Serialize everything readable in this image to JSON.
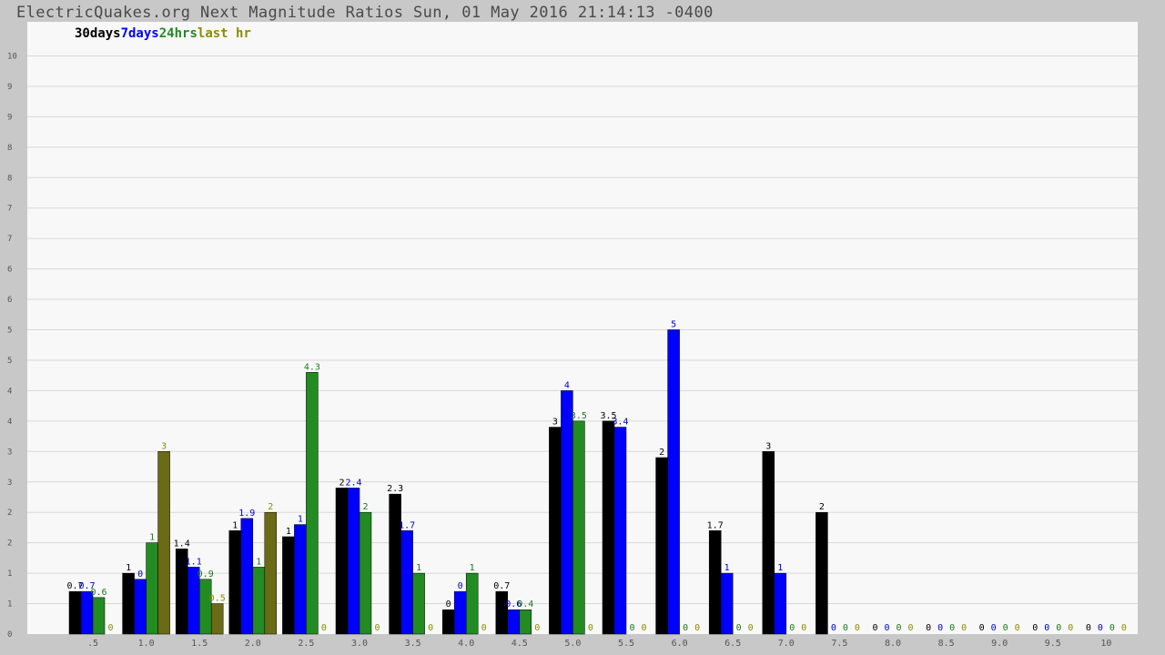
{
  "title": "ElectricQuakes.org Next Magnitude Ratios Sun, 01 May 2016 21:14:13 -0400",
  "colors": {
    "background": "#c8c8c8",
    "plot_bg": "#f8f8f8",
    "grid": "#d8d8d8",
    "series": [
      "#000000",
      "#0000ff",
      "#228b22",
      "#6b6b16"
    ]
  },
  "chart_data": {
    "type": "bar",
    "title": "ElectricQuakes.org Next Magnitude Ratios Sun, 01 May 2016 21:14:13 -0400",
    "xlabel": "",
    "ylabel": "",
    "ylim": [
      0,
      10
    ],
    "grid": true,
    "legend_position": "top-left",
    "categories": [
      ".5",
      "1.0",
      "1.5",
      "2.0",
      "2.5",
      "3.0",
      "3.5",
      "4.0",
      "4.5",
      "5.0",
      "5.5",
      "6.0",
      "6.5",
      "7.0",
      "7.5",
      "8.0",
      "8.5",
      "9.0",
      "9.5",
      "10"
    ],
    "y_tick_labels": [
      "0",
      "1",
      "1",
      "2",
      "2",
      "3",
      "3",
      "4",
      "4",
      "5",
      "5",
      "6",
      "6",
      "7",
      "7",
      "8",
      "8",
      "9",
      "9",
      "10"
    ],
    "series": [
      {
        "name": "30days",
        "values": [
          0.7,
          1.0,
          1.4,
          1.7,
          1.6,
          2.4,
          2.3,
          0.4,
          0.7,
          3.4,
          3.5,
          2.9,
          1.7,
          3.0,
          2.0,
          0,
          0,
          0,
          0,
          0
        ],
        "labels": [
          "0.7",
          "1",
          "1.4",
          "1",
          "1",
          "2",
          "2.3",
          "0",
          "0.7",
          "3",
          "3.5",
          "2",
          "1.7",
          "3",
          "2",
          "0",
          "0",
          "0",
          "0",
          "0"
        ]
      },
      {
        "name": "7days",
        "values": [
          0.7,
          0.9,
          1.1,
          1.9,
          1.8,
          2.4,
          1.7,
          0.7,
          0.4,
          4.0,
          3.4,
          5.0,
          1.0,
          1.0,
          0,
          0,
          0,
          0,
          0,
          0
        ],
        "labels": [
          "0.7",
          "0",
          "1.1",
          "1.9",
          "1",
          "2.4",
          "1.7",
          "0",
          "0.6",
          "4",
          "3.4",
          "5",
          "1",
          "1",
          "0",
          "0",
          "0",
          "0",
          "0",
          "0"
        ]
      },
      {
        "name": "24hrs",
        "values": [
          0.6,
          1.5,
          0.9,
          1.1,
          4.3,
          2.0,
          1.0,
          1.0,
          0.4,
          3.5,
          0,
          0,
          0,
          0,
          0,
          0,
          0,
          0,
          0,
          0
        ],
        "labels": [
          "0.6",
          "1",
          "0.9",
          "1",
          "4.3",
          "2",
          "1",
          "1",
          "0.4",
          "3.5",
          "0",
          "0",
          "0",
          "0",
          "0",
          "0",
          "0",
          "0",
          "0",
          "0"
        ]
      },
      {
        "name": "last hr",
        "values": [
          0,
          3.0,
          0.5,
          2.0,
          0,
          0,
          0,
          0,
          0,
          0,
          0,
          0,
          0,
          0,
          0,
          0,
          0,
          0,
          0,
          0
        ],
        "labels": [
          "0",
          "3",
          "0.5",
          "2",
          "0",
          "0",
          "0",
          "0",
          "0",
          "0",
          "0",
          "0",
          "0",
          "0",
          "0",
          "0",
          "0",
          "0",
          "0",
          "0"
        ]
      }
    ]
  }
}
